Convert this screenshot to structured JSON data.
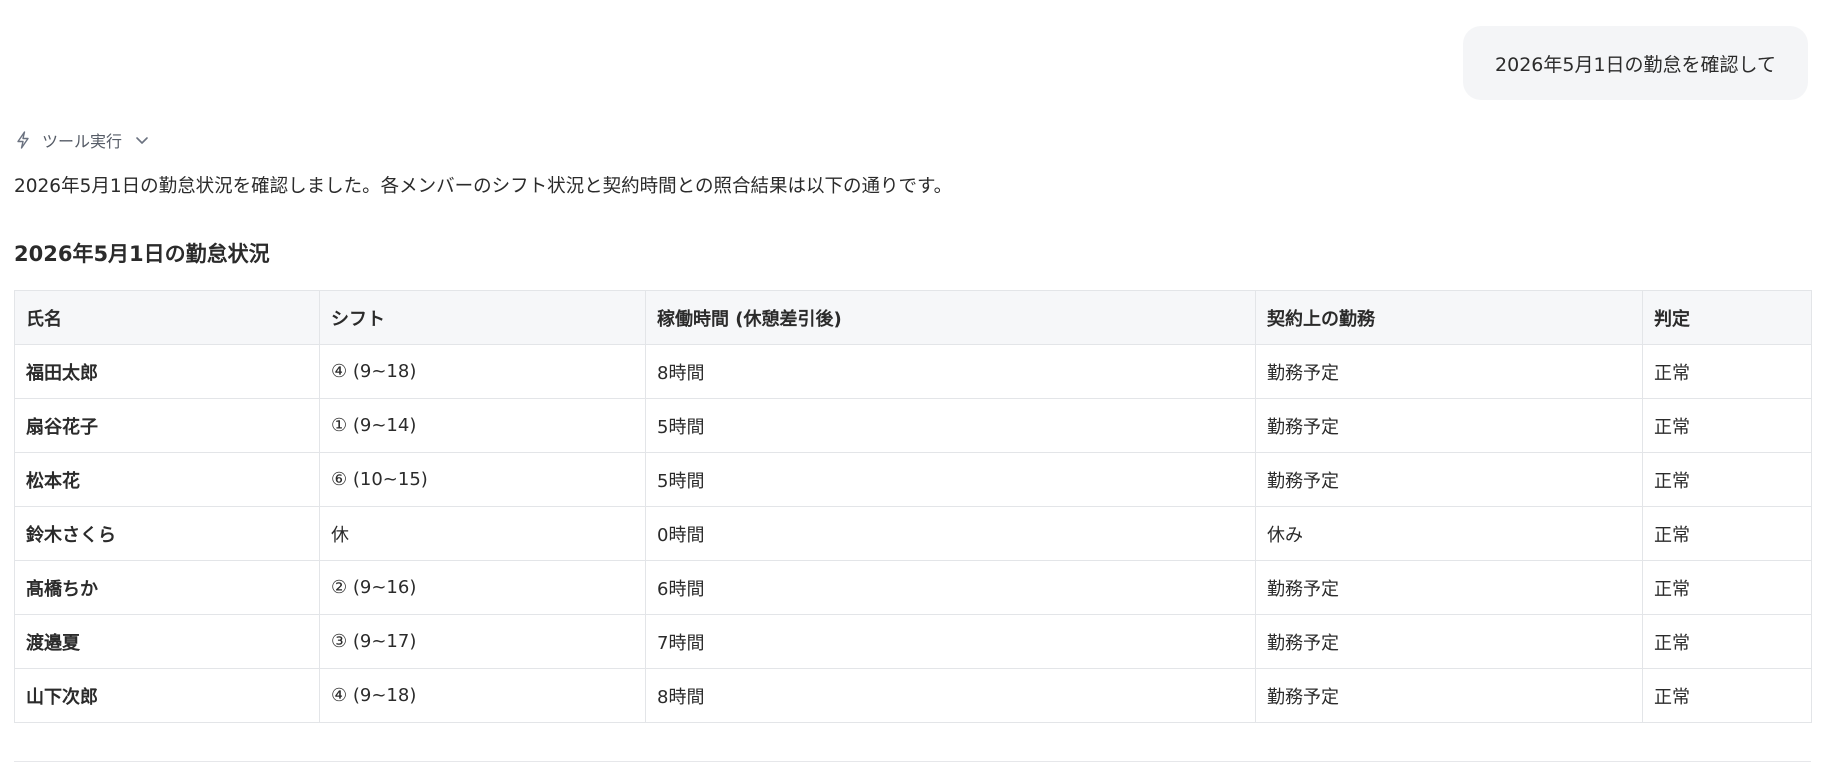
{
  "user_message": "2026年5月1日の勤怠を確認して",
  "tool_execution": {
    "label": "ツール実行",
    "icon": "lightning-icon",
    "toggle_icon": "chevron-down-icon"
  },
  "assistant": {
    "intro": "2026年5月1日の勤怠状況を確認しました。各メンバーのシフト状況と契約時間との照合結果は以下の通りです。",
    "heading": "2026年5月1日の勤怠状況"
  },
  "table": {
    "headers": [
      "氏名",
      "シフト",
      "稼働時間 (休憩差引後)",
      "契約上の勤務",
      "判定"
    ],
    "rows": [
      {
        "name": "福田太郎",
        "shift": "④ (9~18)",
        "hours": "8時間",
        "contract": "勤務予定",
        "judgement": "正常"
      },
      {
        "name": "扇谷花子",
        "shift": "① (9~14)",
        "hours": "5時間",
        "contract": "勤務予定",
        "judgement": "正常"
      },
      {
        "name": "松本花",
        "shift": "⑥ (10~15)",
        "hours": "5時間",
        "contract": "勤務予定",
        "judgement": "正常"
      },
      {
        "name": "鈴木さくら",
        "shift": "休",
        "hours": "0時間",
        "contract": "休み",
        "judgement": "正常"
      },
      {
        "name": "髙橋ちか",
        "shift": "② (9~16)",
        "hours": "6時間",
        "contract": "勤務予定",
        "judgement": "正常"
      },
      {
        "name": "渡邉夏",
        "shift": "③ (9~17)",
        "hours": "7時間",
        "contract": "勤務予定",
        "judgement": "正常"
      },
      {
        "name": "山下次郎",
        "shift": "④ (9~18)",
        "hours": "8時間",
        "contract": "勤務予定",
        "judgement": "正常"
      }
    ]
  },
  "colors": {
    "bubble_bg": "#f4f5f7",
    "header_bg": "#f6f7f9",
    "border": "#e3e5e8",
    "text": "#2b2b2b",
    "muted": "#555b66"
  }
}
